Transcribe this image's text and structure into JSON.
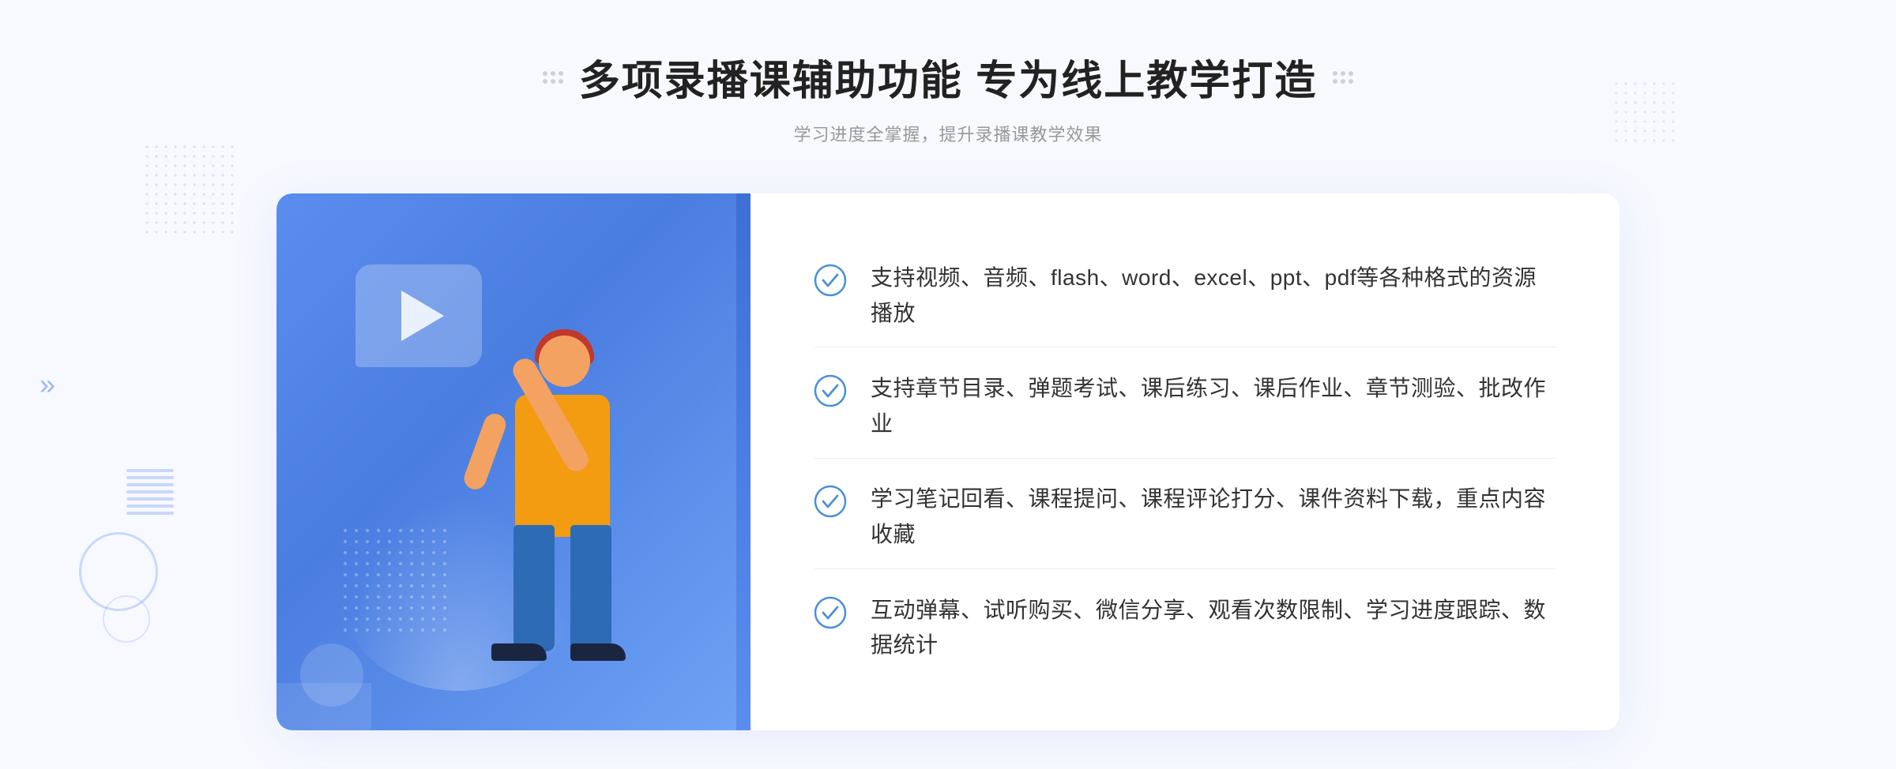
{
  "page": {
    "background_color": "#f8f9ff"
  },
  "header": {
    "main_title": "多项录播课辅助功能 专为线上教学打造",
    "sub_title": "学习进度全掌握，提升录播课教学效果"
  },
  "features": [
    {
      "id": 1,
      "text": "支持视频、音频、flash、word、excel、ppt、pdf等各种格式的资源播放"
    },
    {
      "id": 2,
      "text": "支持章节目录、弹题考试、课后练习、课后作业、章节测验、批改作业"
    },
    {
      "id": 3,
      "text": "学习笔记回看、课程提问、课程评论打分、课件资料下载，重点内容收藏"
    },
    {
      "id": 4,
      "text": "互动弹幕、试听购买、微信分享、观看次数限制、学习进度跟踪、数据统计"
    }
  ],
  "icons": {
    "check_color": "#4a90d9",
    "chevron_left": "»",
    "play_button": "▶"
  }
}
